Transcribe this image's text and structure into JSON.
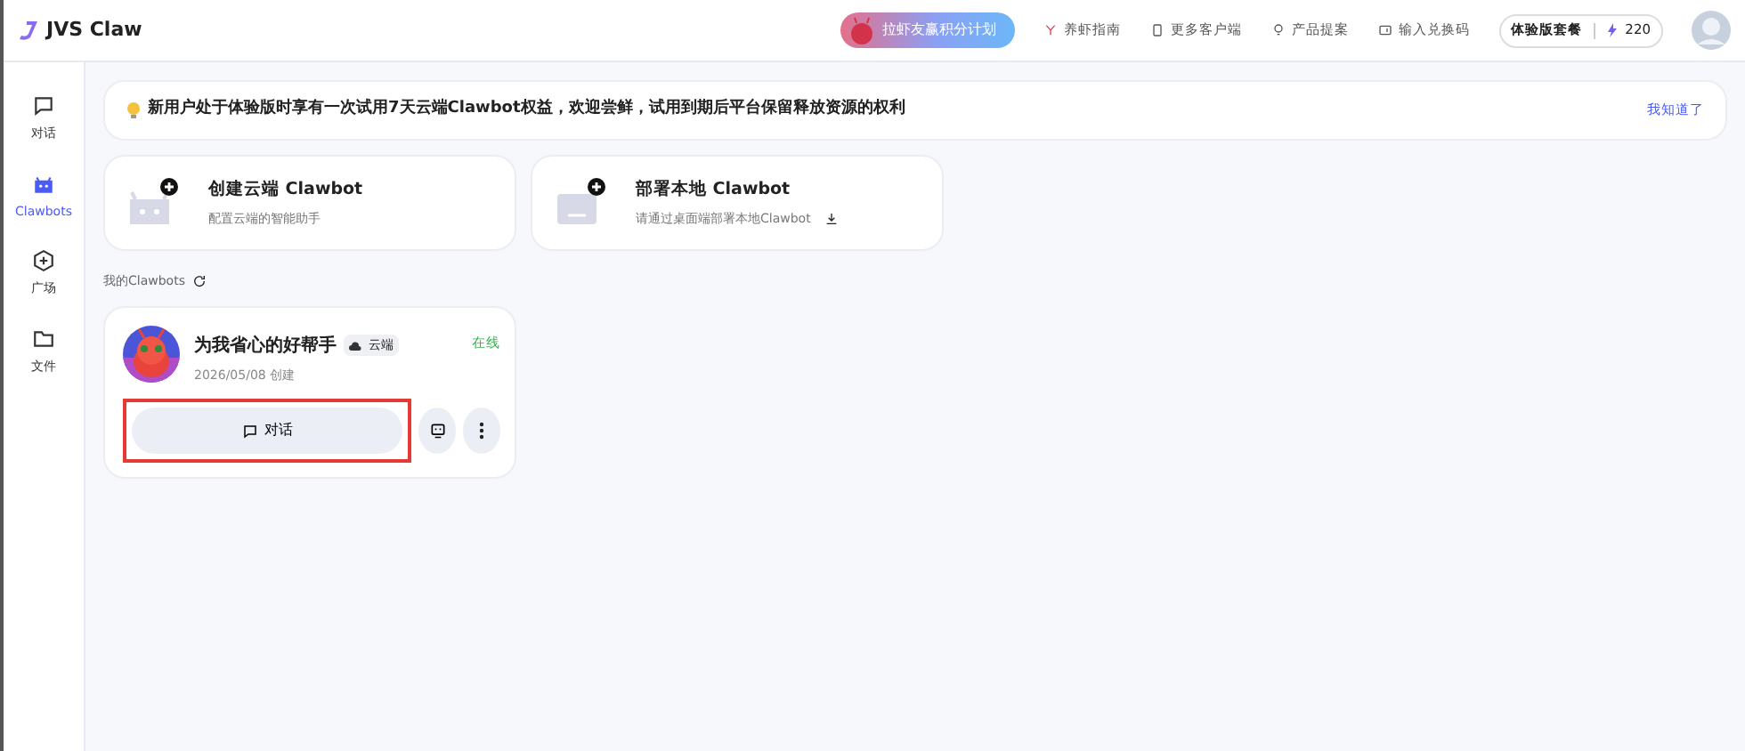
{
  "app": {
    "title": "JVS Claw"
  },
  "header": {
    "promo": "拉虾友赢积分计划",
    "links": [
      {
        "label": "养虾指南"
      },
      {
        "label": "更多客户端"
      },
      {
        "label": "产品提案"
      },
      {
        "label": "输入兑换码"
      }
    ],
    "plan": "体验版套餐",
    "points": "220"
  },
  "sidebar": {
    "items": [
      {
        "label": "对话",
        "selected": false
      },
      {
        "label": "Clawbots",
        "selected": true
      },
      {
        "label": "广场",
        "selected": false
      },
      {
        "label": "文件",
        "selected": false
      }
    ]
  },
  "notice": {
    "text": "新用户处于体验版时享有一次试用7天云端Clawbot权益，欢迎尝鲜，试用到期后平台保留释放资源的权利",
    "action": "我知道了"
  },
  "create_cards": [
    {
      "title": "创建云端 Clawbot",
      "subtitle": "配置云端的智能助手"
    },
    {
      "title": "部署本地 Clawbot",
      "subtitle": "请通过桌面端部署本地Clawbot"
    }
  ],
  "section_title": "我的Clawbots",
  "bots": [
    {
      "name": "为我省心的好帮手",
      "tag": "云端",
      "status": "在线",
      "created": "2026/05/08 创建",
      "chat_button": "对话",
      "highlighted": true
    }
  ]
}
